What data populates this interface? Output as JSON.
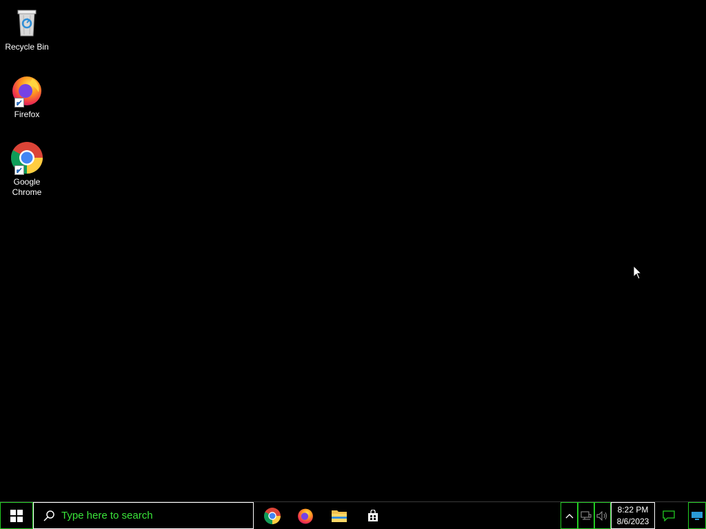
{
  "desktop": {
    "icons": [
      {
        "label": "Recycle Bin",
        "icon": "recycle-bin-icon"
      },
      {
        "label": "Firefox",
        "icon": "firefox-icon"
      },
      {
        "label": "Google Chrome",
        "icon": "chrome-icon"
      }
    ]
  },
  "taskbar": {
    "start_icon": "windows-logo-icon",
    "search": {
      "placeholder": "Type here to search",
      "icon": "search-icon"
    },
    "pinned": [
      {
        "name": "Google Chrome",
        "icon": "chrome-icon"
      },
      {
        "name": "Firefox",
        "icon": "firefox-icon"
      },
      {
        "name": "File Explorer",
        "icon": "folder-icon"
      },
      {
        "name": "Microsoft Store",
        "icon": "store-icon"
      }
    ],
    "tray": {
      "time": "8:22 PM",
      "date": "8/6/2023"
    }
  },
  "colors": {
    "background": "#000000",
    "accent_green": "#22cc22",
    "search_text": "#3ae43a"
  }
}
